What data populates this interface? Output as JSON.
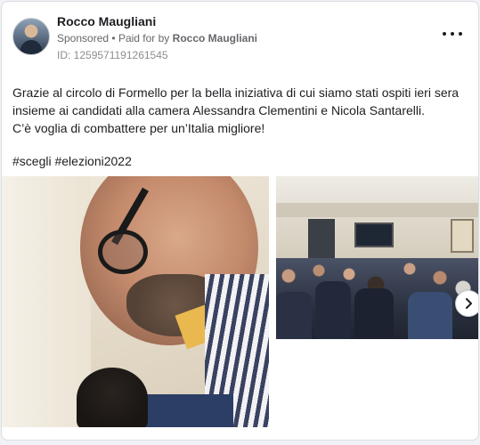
{
  "post": {
    "author": "Rocco Maugliani",
    "sponsored_label": "Sponsored",
    "separator": "•",
    "paid_for_prefix": "Paid for by",
    "paid_for_name": "Rocco Maugliani",
    "ad_id": "ID: 1259571191261545",
    "body_lines": [
      "Grazie al circolo di Formello per la bella iniziativa di cui siamo stati ospiti ieri sera insieme ai candidati alla camera Alessandra Clementini e Nicola Santarelli.",
      "C’è voglia di combattere per un’Italia migliore!"
    ],
    "hashtags": "#scegli #elezioni2022",
    "more_icon": "more-horizontal-icon",
    "next_icon": "chevron-right-icon"
  },
  "colors": {
    "background": "#f0f2f5",
    "card": "#ffffff",
    "text": "#1c1e21",
    "secondary_text": "#65676b"
  }
}
